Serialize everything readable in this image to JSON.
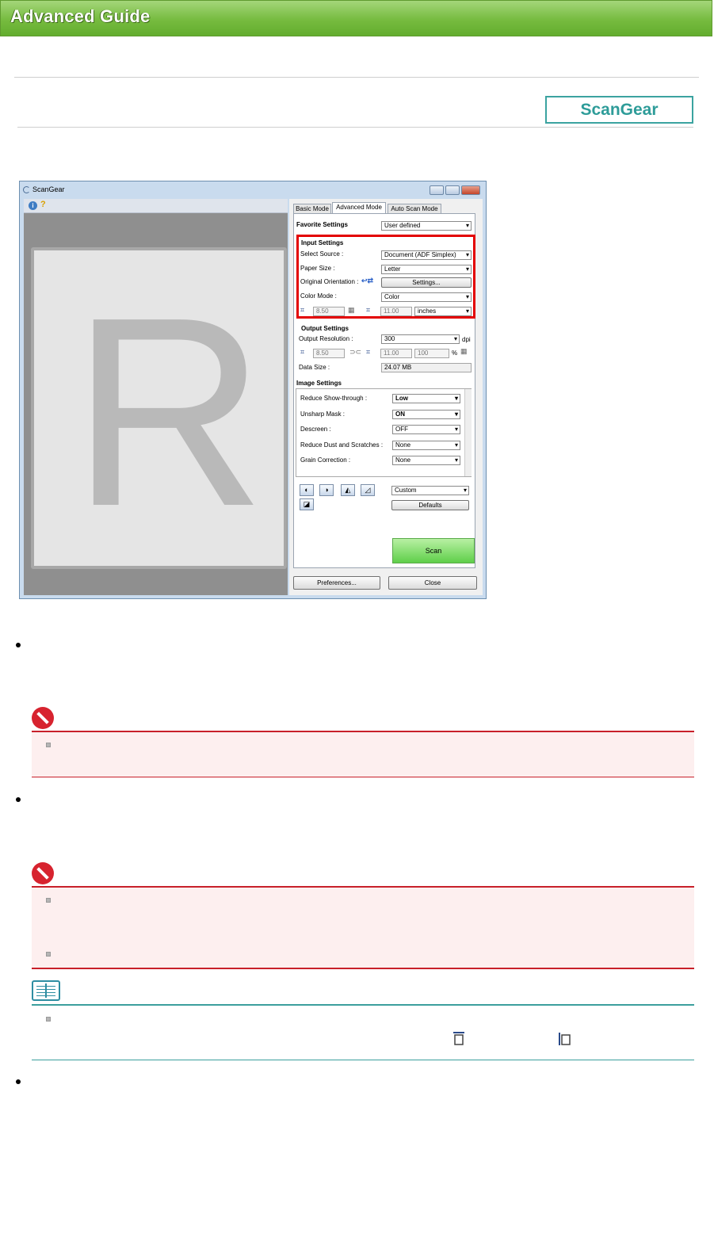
{
  "header": {
    "title": "Advanced Guide"
  },
  "section_tag": "ScanGear",
  "screenshot": {
    "window_title": "ScanGear",
    "toolbar_icons": [
      "info-icon",
      "help-icon"
    ],
    "preview_letter": "R",
    "tabs": [
      "Basic Mode",
      "Advanced Mode",
      "Auto Scan Mode"
    ],
    "favorite_settings": {
      "label": "Favorite Settings",
      "value": "User defined"
    },
    "input_settings": {
      "heading": "Input Settings",
      "select_source": {
        "label": "Select Source :",
        "value": "Document (ADF Simplex)"
      },
      "paper_size": {
        "label": "Paper Size :",
        "value": "Letter"
      },
      "original_orientation": {
        "label": "Original Orientation :",
        "button": "Settings..."
      },
      "color_mode": {
        "label": "Color Mode :",
        "value": "Color"
      },
      "width": "8.50",
      "height": "11.00",
      "unit": "inches"
    },
    "output_settings": {
      "heading": "Output Settings",
      "resolution": {
        "label": "Output Resolution :",
        "value": "300",
        "unit": "dpi"
      },
      "width": "8.50",
      "height": "11.00",
      "scale": "100",
      "percent": "%",
      "data_size": {
        "label": "Data Size :",
        "value": "24.07 MB"
      }
    },
    "image_settings": {
      "heading": "Image Settings",
      "rows": [
        {
          "label": "Reduce Show-through :",
          "value": "Low"
        },
        {
          "label": "Unsharp Mask :",
          "value": "ON"
        },
        {
          "label": "Descreen :",
          "value": "OFF"
        },
        {
          "label": "Reduce Dust and Scratches :",
          "value": "None"
        },
        {
          "label": "Grain Correction :",
          "value": "None"
        }
      ]
    },
    "adjust": {
      "preset": "Custom",
      "defaults": "Defaults"
    },
    "scan_button": "Scan",
    "preferences_button": "Preferences...",
    "close_button": "Close"
  },
  "colors": {
    "header_green": "#76bb3f",
    "caution_red": "#c8202a",
    "note_teal": "#3c9f9d",
    "tag_teal": "#2e9c99"
  }
}
